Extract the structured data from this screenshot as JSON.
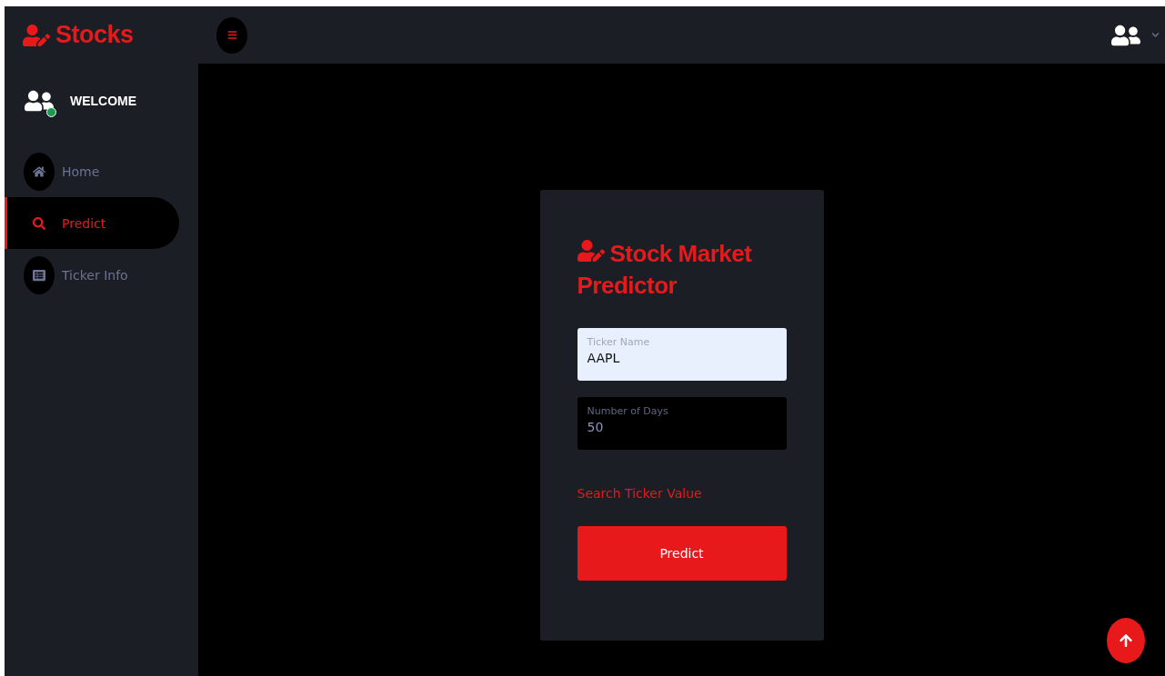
{
  "brand": {
    "title": "Stocks"
  },
  "sidebar": {
    "welcome": "WELCOME",
    "online": true,
    "items": [
      {
        "label": "Home",
        "selected": false
      },
      {
        "label": "Predict",
        "selected": true
      },
      {
        "label": "Ticker Info",
        "selected": false
      }
    ]
  },
  "card": {
    "title": "Stock Market Predictor",
    "fields": [
      {
        "label": "Ticker Name",
        "value": "AAPL",
        "autofilled": true
      },
      {
        "label": "Number of Days",
        "value": "50",
        "autofilled": false
      }
    ],
    "link": "Search Ticker Value",
    "button": "Predict"
  }
}
